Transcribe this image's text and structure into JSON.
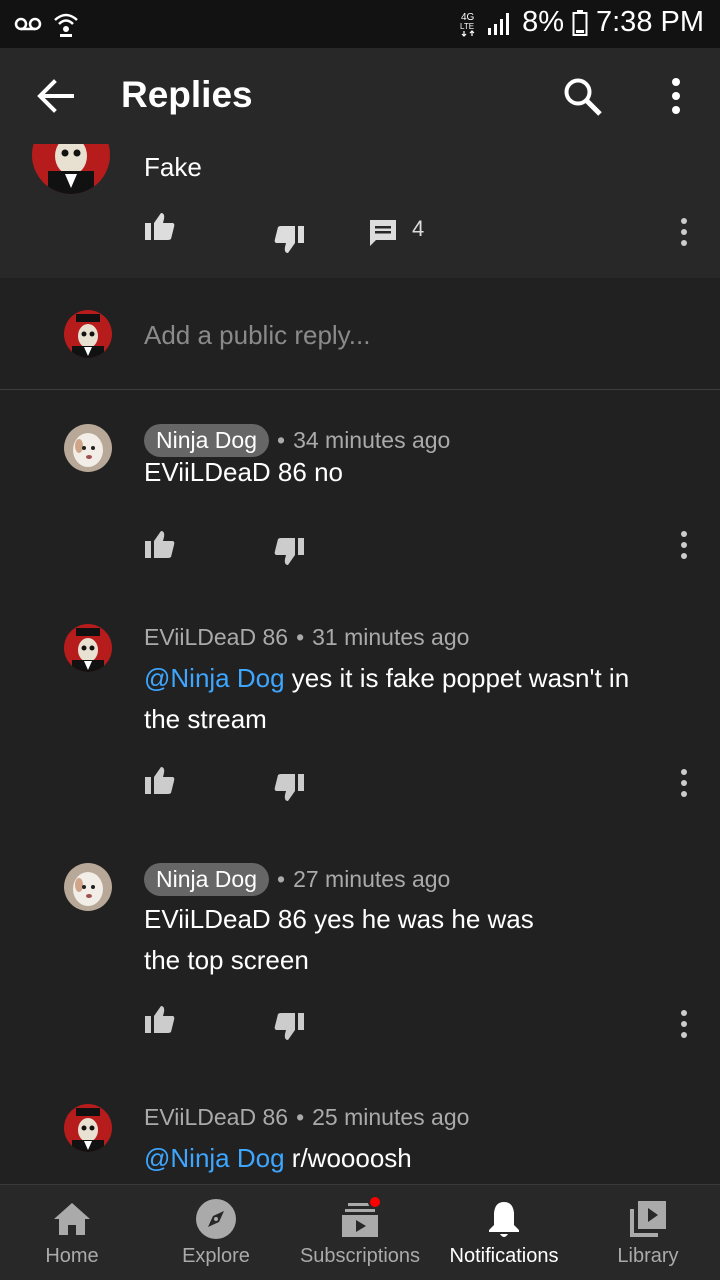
{
  "status_bar": {
    "battery": "8%",
    "time": "7:38 PM",
    "network": "4G LTE"
  },
  "header": {
    "title": "Replies"
  },
  "parent_comment": {
    "text": "Fake",
    "reply_count": "4"
  },
  "reply_input": {
    "placeholder": "Add a public reply..."
  },
  "comments": [
    {
      "author": "Ninja Dog",
      "time": "34 minutes ago",
      "mention": "",
      "text": "EViiLDeaD 86 no"
    },
    {
      "author": "EViiLDeaD 86",
      "time": "31 minutes ago",
      "mention": "@Ninja Dog",
      "text": " yes it is fake poppet wasn't in the stream"
    },
    {
      "author": "Ninja Dog",
      "time": "27 minutes ago",
      "mention": "",
      "text": "EViiLDeaD 86 yes he was he was the top screen"
    },
    {
      "author": "EViiLDeaD 86",
      "time": "25 minutes ago",
      "mention": "@Ninja Dog",
      "text": " r/woooosh"
    }
  ],
  "bottom_nav": {
    "items": [
      {
        "label": "Home",
        "icon": "home-icon"
      },
      {
        "label": "Explore",
        "icon": "compass-icon"
      },
      {
        "label": "Subscriptions",
        "icon": "subscriptions-icon"
      },
      {
        "label": "Notifications",
        "icon": "bell-icon"
      },
      {
        "label": "Library",
        "icon": "library-icon"
      }
    ],
    "active": "Notifications"
  },
  "colors": {
    "background": "#212121",
    "header": "#282828",
    "mention": "#3ea6ff",
    "notification_dot": "#ff0000"
  }
}
